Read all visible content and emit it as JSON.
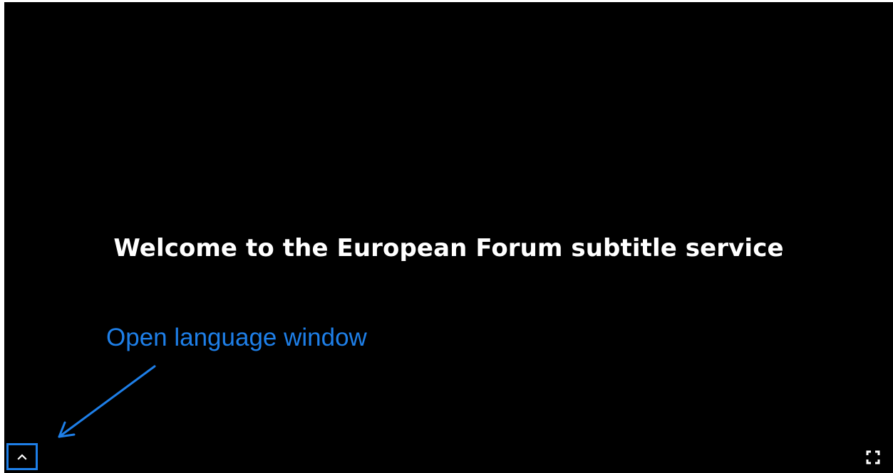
{
  "player": {
    "subtitle_text": "Welcome to the European Forum subtitle service",
    "open_language_button_icon": "chevron-up-icon",
    "fullscreen_button_icon": "fullscreen-icon"
  },
  "annotation": {
    "text": "Open language window",
    "color": "#1e7fe8"
  },
  "colors": {
    "background": "#000000",
    "subtitle": "#ffffff",
    "accent": "#1e7fe8"
  }
}
